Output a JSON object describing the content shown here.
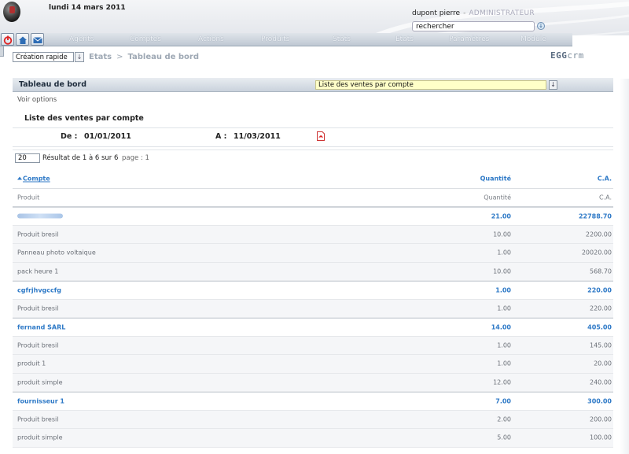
{
  "header": {
    "date": "lundi 14 mars 2011",
    "user_name": "dupont pierre",
    "separator": "-",
    "user_role": "ADMINISTRATEUR",
    "search_value": "rechercher"
  },
  "nav": {
    "tabs": [
      "Agents",
      "Comptes",
      "Actions",
      "Produits",
      "Stats",
      "Etats",
      "Paramètres",
      "Module"
    ]
  },
  "toolbar": {
    "quick_create": "Création rapide",
    "breadcrumb": [
      "Etats",
      "Tableau de bord"
    ],
    "brand_egg": "EGG",
    "brand_crm": "crm"
  },
  "dashboard": {
    "title": "Tableau de bord",
    "report_selected": "Liste des ventes par compte",
    "voir_options": "Voir options"
  },
  "report": {
    "title": "Liste des ventes par compte",
    "from_label": "De :",
    "from_value": "01/01/2011",
    "to_label": "A :",
    "to_value": "11/03/2011"
  },
  "paging": {
    "per_page": "20",
    "result_text": "Résultat de 1 à 6 sur 6",
    "page_text": "page : 1"
  },
  "table": {
    "header": {
      "col1": "Compte",
      "col2": "Quantité",
      "col3": "C.A."
    },
    "subheader": {
      "col1": "Produit",
      "col2": "Quantité",
      "col3": "C.A."
    },
    "groups": [
      {
        "name": "",
        "redacted": true,
        "qty": "21.00",
        "ca": "22788.70",
        "items": [
          {
            "name": "Produit bresil",
            "qty": "10.00",
            "ca": "2200.00"
          },
          {
            "name": "Panneau photo voltaique",
            "qty": "1.00",
            "ca": "20020.00"
          },
          {
            "name": "pack heure 1",
            "qty": "10.00",
            "ca": "568.70"
          }
        ]
      },
      {
        "name": "cgfrjhvgccfg",
        "qty": "1.00",
        "ca": "220.00",
        "items": [
          {
            "name": "Produit bresil",
            "qty": "1.00",
            "ca": "220.00"
          }
        ]
      },
      {
        "name": "fernand SARL",
        "qty": "14.00",
        "ca": "405.00",
        "items": [
          {
            "name": "Produit bresil",
            "qty": "1.00",
            "ca": "145.00"
          },
          {
            "name": "produit 1",
            "qty": "1.00",
            "ca": "20.00"
          },
          {
            "name": "produit simple",
            "qty": "12.00",
            "ca": "240.00"
          }
        ]
      },
      {
        "name": "fournisseur 1",
        "qty": "7.00",
        "ca": "300.00",
        "items": [
          {
            "name": "Produit bresil",
            "qty": "2.00",
            "ca": "200.00"
          },
          {
            "name": "produit simple",
            "qty": "5.00",
            "ca": "100.00"
          }
        ]
      }
    ]
  },
  "colors": {
    "link_blue": "#2f7ac7",
    "report_select_bg": "#ffffc8",
    "nav_text": "#f2f5f9"
  }
}
